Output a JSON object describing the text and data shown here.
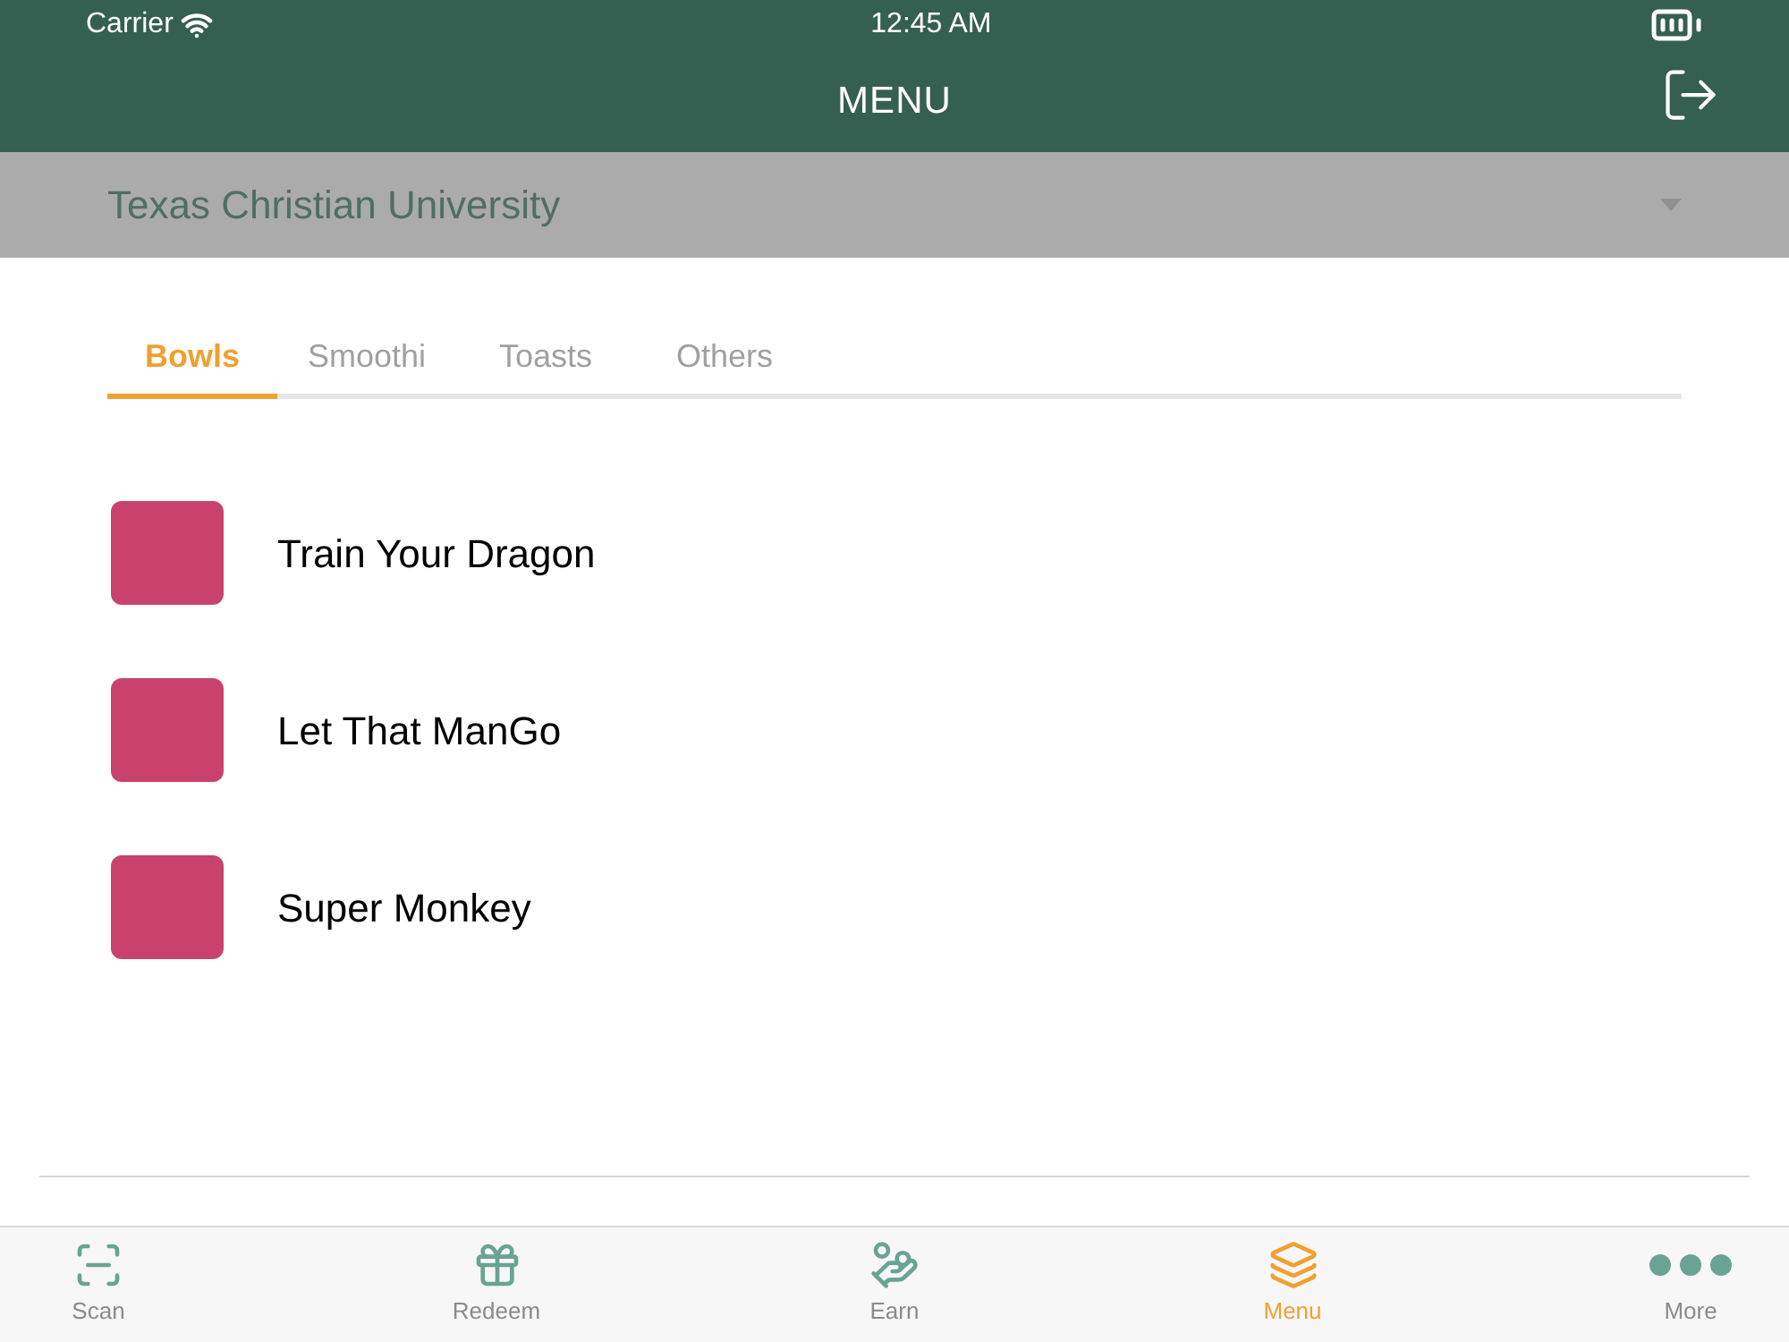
{
  "status_bar": {
    "carrier": "Carrier",
    "time": "12:45 AM"
  },
  "header": {
    "title": "MENU"
  },
  "location_picker": {
    "value": "Texas Christian University"
  },
  "tabs": [
    {
      "label": "Bowls",
      "selected": true
    },
    {
      "label": "Smoothi",
      "selected": false
    },
    {
      "label": "Toasts",
      "selected": false
    },
    {
      "label": "Others",
      "selected": false
    }
  ],
  "items": [
    {
      "name": "Train Your Dragon"
    },
    {
      "name": "Let That ManGo"
    },
    {
      "name": "Super Monkey"
    }
  ],
  "tab_bar": [
    {
      "label": "Scan",
      "selected": false
    },
    {
      "label": "Redeem",
      "selected": false
    },
    {
      "label": "Earn",
      "selected": false
    },
    {
      "label": "Menu",
      "selected": true
    },
    {
      "label": "More",
      "selected": false
    }
  ]
}
